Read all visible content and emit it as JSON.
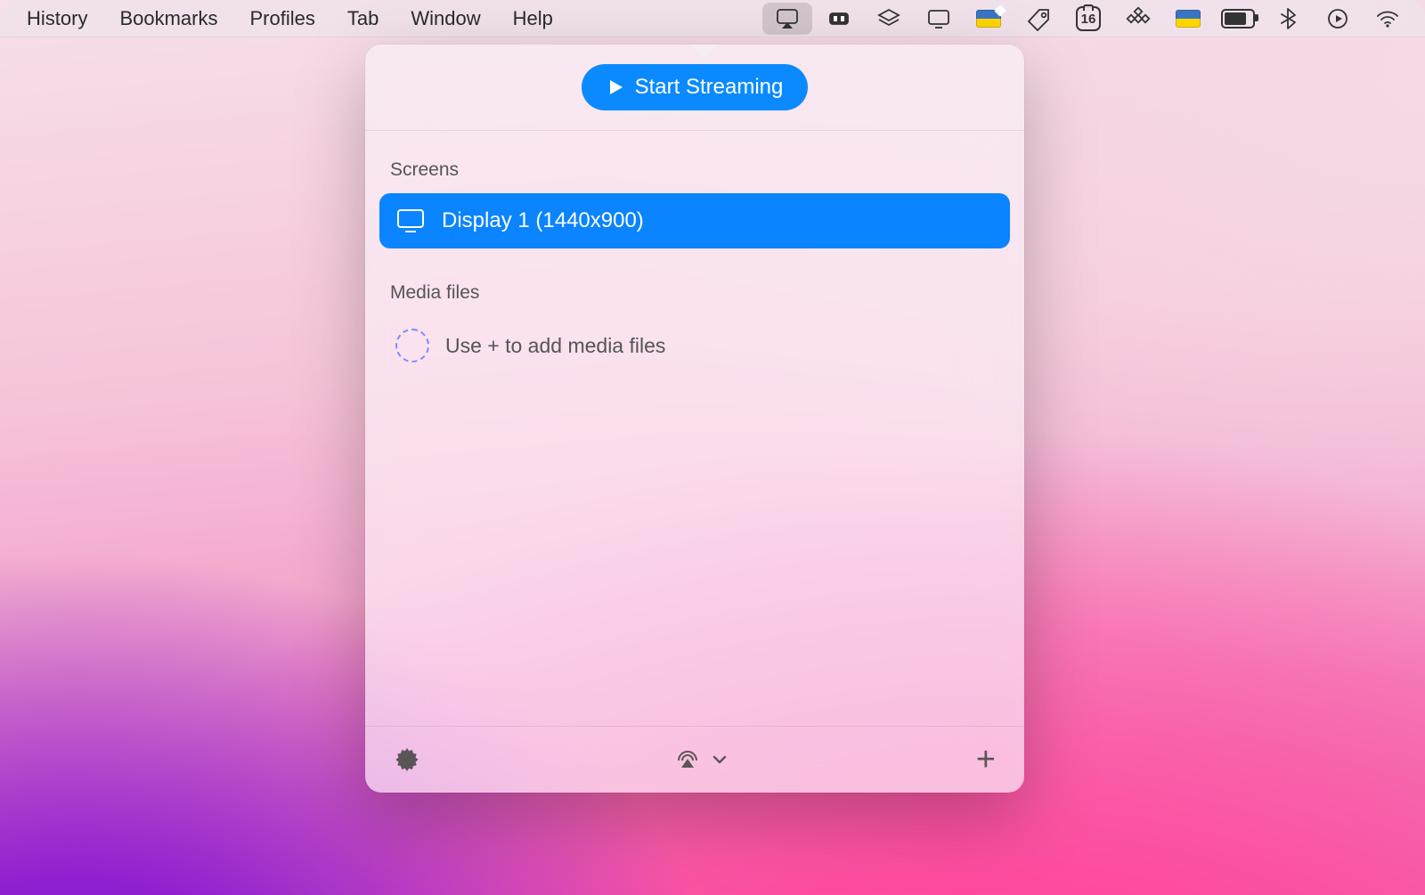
{
  "menubar": {
    "items": [
      "History",
      "Bookmarks",
      "Profiles",
      "Tab",
      "Window",
      "Help"
    ]
  },
  "status": {
    "calendar_day": "16"
  },
  "popover": {
    "start_label": "Start Streaming",
    "screens_title": "Screens",
    "screen_items": [
      {
        "label": "Display 1 (1440x900)"
      }
    ],
    "media_title": "Media files",
    "media_placeholder": "Use + to add media files"
  },
  "colors": {
    "accent": "#0a84ff"
  }
}
